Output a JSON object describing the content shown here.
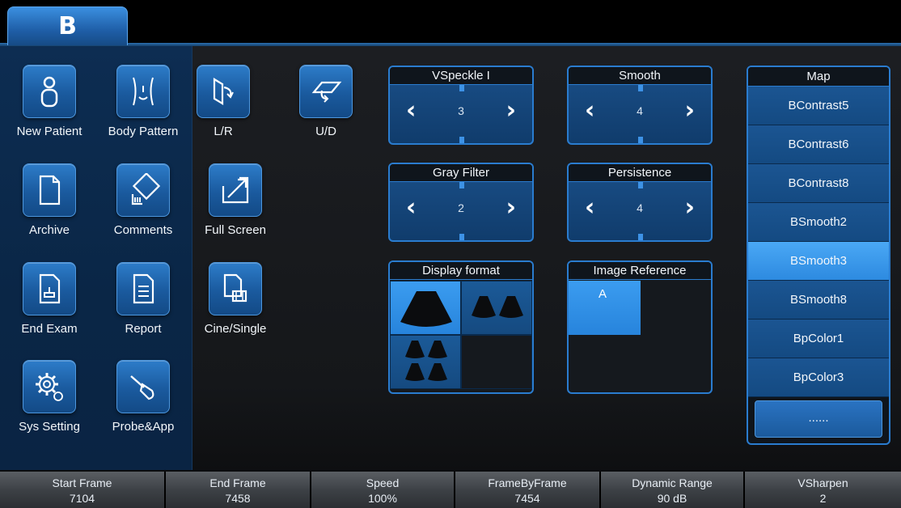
{
  "mode_tab": {
    "label": "B"
  },
  "left_buttons": [
    {
      "label": "New Patient",
      "icon": "new-patient-icon"
    },
    {
      "label": "Body Pattern",
      "icon": "body-pattern-icon"
    },
    {
      "label": "Archive",
      "icon": "archive-icon"
    },
    {
      "label": "Comments",
      "icon": "comments-icon"
    },
    {
      "label": "End Exam",
      "icon": "end-exam-icon"
    },
    {
      "label": "Report",
      "icon": "report-icon"
    },
    {
      "label": "Sys Setting",
      "icon": "gear-icon"
    },
    {
      "label": "Probe&App",
      "icon": "probe-icon"
    }
  ],
  "image_buttons": [
    {
      "label": "L/R",
      "icon": "flip-lr-icon"
    },
    {
      "label": "U/D",
      "icon": "flip-ud-icon"
    },
    {
      "label": "Full Screen",
      "icon": "full-screen-icon"
    },
    {
      "label": "Cine/Single",
      "icon": "cine-single-icon"
    }
  ],
  "params": [
    {
      "title": "VSpeckle  I",
      "value": "3"
    },
    {
      "title": "Smooth",
      "value": "4"
    },
    {
      "title": "Gray Filter",
      "value": "2"
    },
    {
      "title": "Persistence",
      "value": "4"
    }
  ],
  "arrows": {
    "left": "‹",
    "right": "›"
  },
  "display_format": {
    "title": "Display format",
    "selected": "single"
  },
  "image_reference": {
    "title": "Image Reference",
    "selected_label": "A"
  },
  "map": {
    "title": "Map",
    "items": [
      "BContrast5",
      "BContrast6",
      "BContrast8",
      "BSmooth2",
      "BSmooth3",
      "BSmooth8",
      "BpColor1",
      "BpColor3"
    ],
    "selected": "BSmooth3",
    "more_label": "......"
  },
  "bottom_bar": [
    {
      "label": "Start Frame",
      "value": "7104"
    },
    {
      "label": "End Frame",
      "value": "7458"
    },
    {
      "label": "Speed",
      "value": "100%"
    },
    {
      "label": "FrameByFrame",
      "value": "7454"
    },
    {
      "label": "Dynamic Range",
      "value": "90 dB"
    },
    {
      "label": "VSharpen",
      "value": "2"
    }
  ],
  "colors": {
    "accent": "#2a7ccf",
    "selected": "#3b9cf0",
    "panel": "#0d2d52"
  }
}
